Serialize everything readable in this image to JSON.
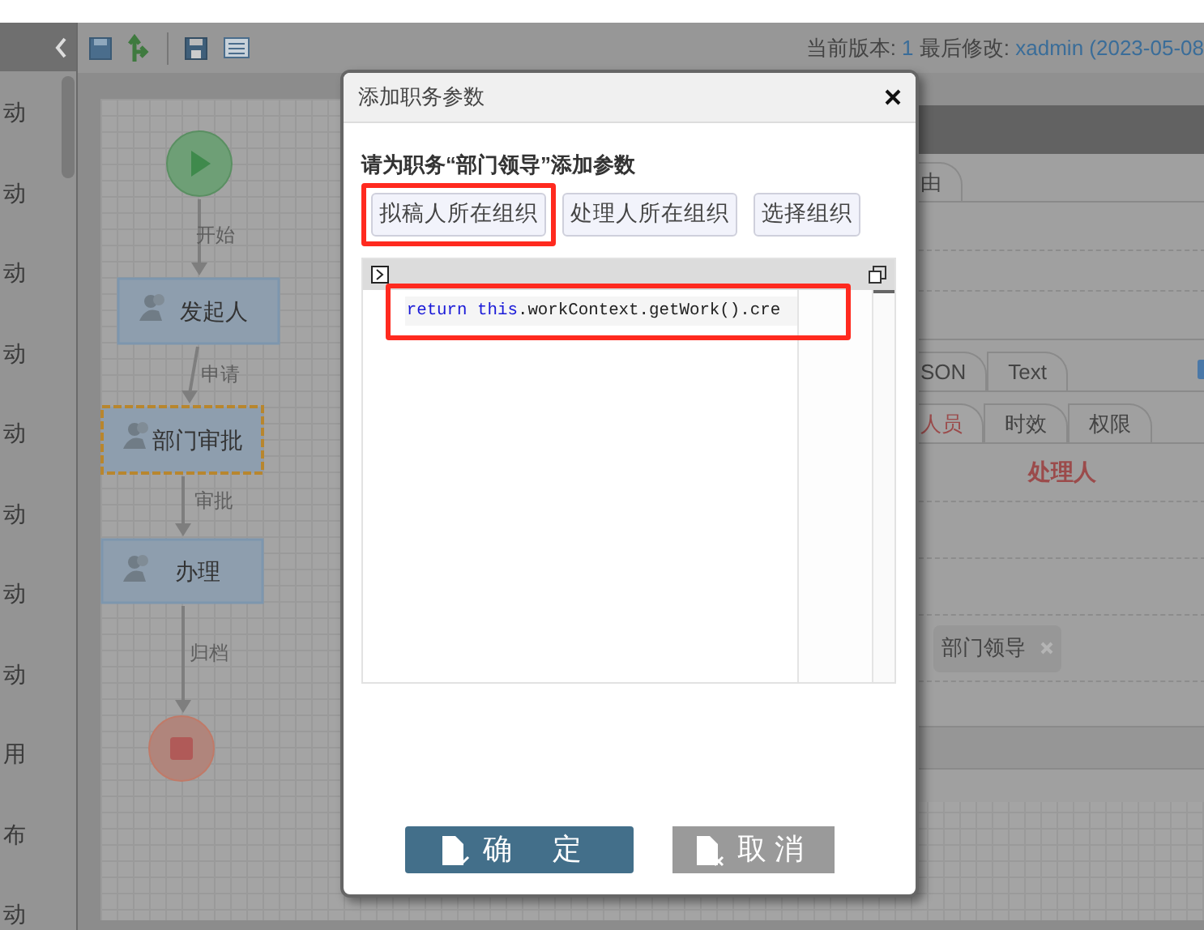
{
  "header": {
    "version_label": "当前版本:",
    "version": "1",
    "modified_label": "最后修改:",
    "modified_by": "xadmin (2023-05-08"
  },
  "sidebar": {
    "items": [
      {
        "label": "动"
      },
      {
        "label": "动"
      },
      {
        "label": "动"
      },
      {
        "label": "动"
      },
      {
        "label": "动"
      },
      {
        "label": "动"
      },
      {
        "label": "动"
      },
      {
        "label": "动"
      },
      {
        "label": "用"
      },
      {
        "label": "布"
      },
      {
        "label": "动"
      }
    ]
  },
  "flow": {
    "nodes": [
      {
        "kind": "start",
        "selected": false
      },
      {
        "kind": "task",
        "label": "发起人",
        "selected": false
      },
      {
        "kind": "task",
        "label": "部门审批",
        "selected": true
      },
      {
        "kind": "task",
        "label": "办理",
        "selected": false
      },
      {
        "kind": "end",
        "selected": false
      }
    ],
    "edges": [
      "开始",
      "申请",
      "审批",
      "归档"
    ]
  },
  "panel": {
    "route_tabs": [
      {
        "label": "由"
      }
    ],
    "format_tabs": [
      {
        "label": "SON"
      },
      {
        "label": "Text"
      }
    ],
    "property_tabs": [
      {
        "label": "人员",
        "selected": true
      },
      {
        "label": "时效",
        "selected": false
      },
      {
        "label": "权限",
        "selected": false
      }
    ],
    "heading": "处理人",
    "tags": [
      {
        "label": "部门领导"
      }
    ]
  },
  "dialog": {
    "title": "添加职务参数",
    "prompt": "请为职务“部门领导”添加参数",
    "options": [
      {
        "label": "拟稿人所在组织",
        "highlighted": true
      },
      {
        "label": "处理人所在组织",
        "highlighted": false
      },
      {
        "label": "选择组织",
        "highlighted": false
      }
    ],
    "code": {
      "highlighted": true,
      "tokens": [
        {
          "kind": "keyword",
          "text": "return "
        },
        {
          "kind": "keyword",
          "text": "this"
        },
        {
          "kind": "plain",
          "text": ".workContext.getWork().cre"
        }
      ]
    },
    "buttons": [
      {
        "kind": "confirm",
        "label": "确 定"
      },
      {
        "kind": "cancel",
        "label": "取消"
      }
    ]
  }
}
